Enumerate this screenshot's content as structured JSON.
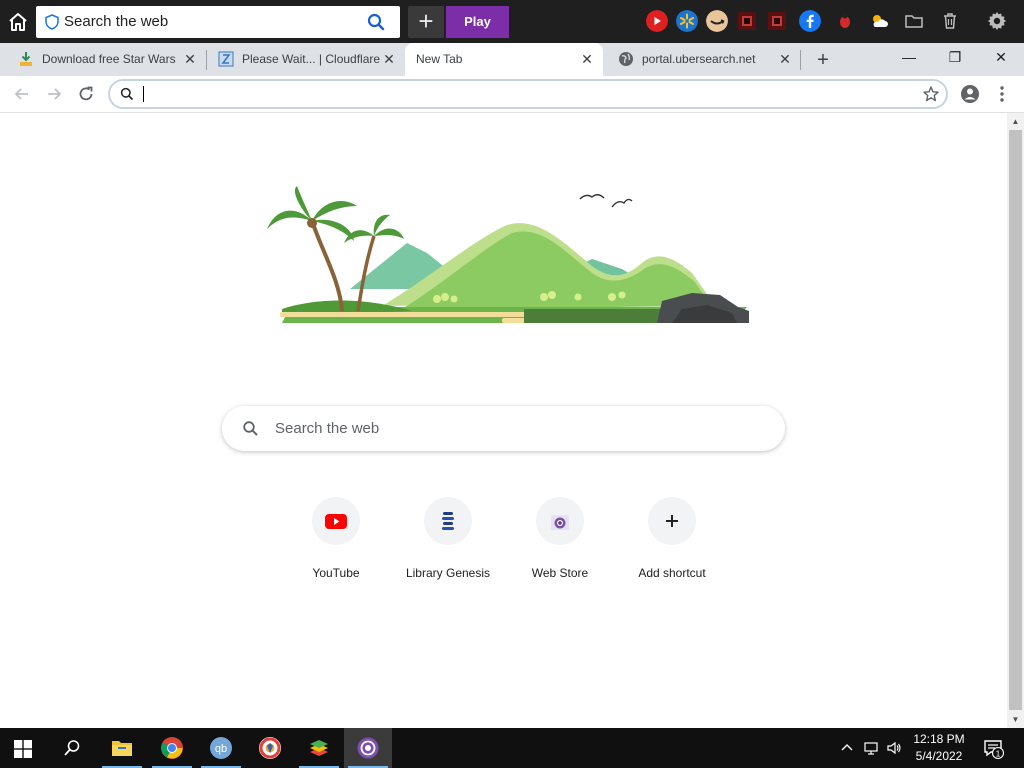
{
  "toolbar": {
    "search_label": "Search the web",
    "play_label": "Play",
    "play_color": "#7b2ea8",
    "extensions": [
      "youtube-icon",
      "walmart-icon",
      "amazon-icon",
      "news-icon",
      "news-icon",
      "facebook-icon",
      "bug-icon",
      "weather-icon",
      "folder-icon",
      "trash-icon"
    ]
  },
  "tabs": [
    {
      "title": "Download free Star Wars",
      "favicon": "download-icon",
      "active": false
    },
    {
      "title": "Please Wait... | Cloudflare",
      "favicon": "cloudflare-icon",
      "active": false
    },
    {
      "title": "New Tab",
      "favicon": "",
      "active": true
    },
    {
      "title": "portal.ubersearch.net",
      "favicon": "globe-icon",
      "active": false
    }
  ],
  "window_controls": {
    "minimize": "—",
    "maximize": "❐",
    "close": "✕"
  },
  "omnibox": {
    "value": "",
    "placeholder": ""
  },
  "ntp": {
    "search_placeholder": "Search the web",
    "shortcuts": [
      {
        "name": "YouTube",
        "icon": "youtube-icon"
      },
      {
        "name": "Library Genesis",
        "icon": "library-genesis-icon"
      },
      {
        "name": "Web Store",
        "icon": "web-store-icon"
      },
      {
        "name": "Add shortcut",
        "icon": "plus-icon"
      }
    ]
  },
  "taskbar": {
    "apps": [
      "file-explorer-icon",
      "chrome-icon",
      "qbittorrent-icon",
      "brave-icon",
      "bluestacks-icon",
      "tor-browser-icon"
    ],
    "time": "12:18 PM",
    "date": "5/4/2022",
    "notification_count": "1"
  }
}
